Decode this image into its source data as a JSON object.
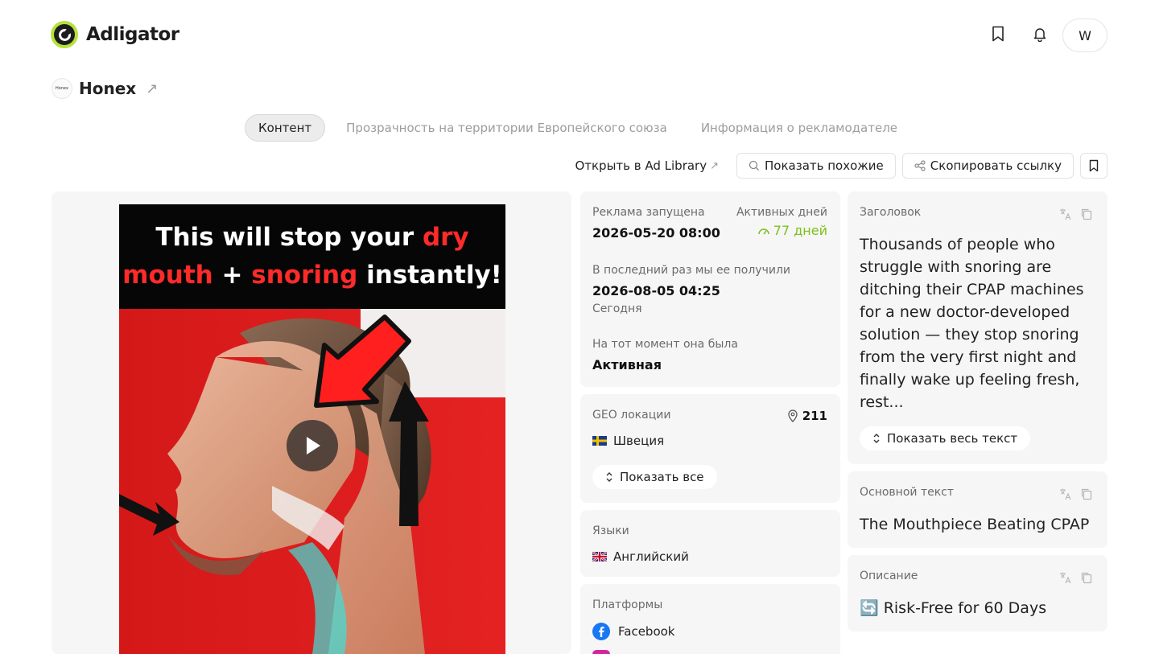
{
  "header": {
    "logo_text": "Adligator",
    "avatar_initial": "W"
  },
  "brand": {
    "logo_text": "Honex",
    "name": "Honex"
  },
  "tabs": [
    {
      "label": "Контент",
      "active": true
    },
    {
      "label": "Прозрачность на территории Европейского союза",
      "active": false
    },
    {
      "label": "Информация о рекламодателе",
      "active": false
    }
  ],
  "actions": {
    "open_library": "Открыть в Ad Library",
    "show_similar": "Показать похожие",
    "copy_link": "Скопировать ссылку"
  },
  "media": {
    "line1_a": "This will stop your ",
    "line1_b": "dry",
    "line2_a": "mouth",
    "line2_b": " + ",
    "line2_c": "snoring",
    "line2_d": " instantly!"
  },
  "info": {
    "launched_label": "Реклама запущена",
    "launched_value": "2026-05-20 08:00",
    "active_days_label": "Активных дней",
    "active_days_value": "77 дней",
    "last_seen_label": "В последний раз мы ее получили",
    "last_seen_value": "2026-08-05 04:25",
    "last_seen_sub": "Сегодня",
    "status_label": "На тот момент она была",
    "status_value": "Активная"
  },
  "geo": {
    "label": "GEO локации",
    "count": "211",
    "country": "Швеция",
    "show_all": "Показать все"
  },
  "languages": {
    "label": "Языки",
    "value": "Английский"
  },
  "platforms": {
    "label": "Платформы",
    "items": [
      "Facebook"
    ]
  },
  "headline": {
    "label": "Заголовок",
    "text": "Thousands of people who struggle with snoring are ditching their CPAP machines for a new doctor-developed solution — they stop snoring from the very first night and finally wake up feeling fresh, rest...",
    "show_full": "Показать весь текст"
  },
  "body_text": {
    "label": "Основной текст",
    "text": "The Mouthpiece Beating CPAP"
  },
  "description": {
    "label": "Описание",
    "text": "🔄 Risk-Free for 60 Days"
  },
  "colors": {
    "accent_green": "#7cc01a",
    "brand_green": "#b6e23a",
    "card_bg": "#f6f6f7",
    "ad_red": "#d81d1d"
  }
}
